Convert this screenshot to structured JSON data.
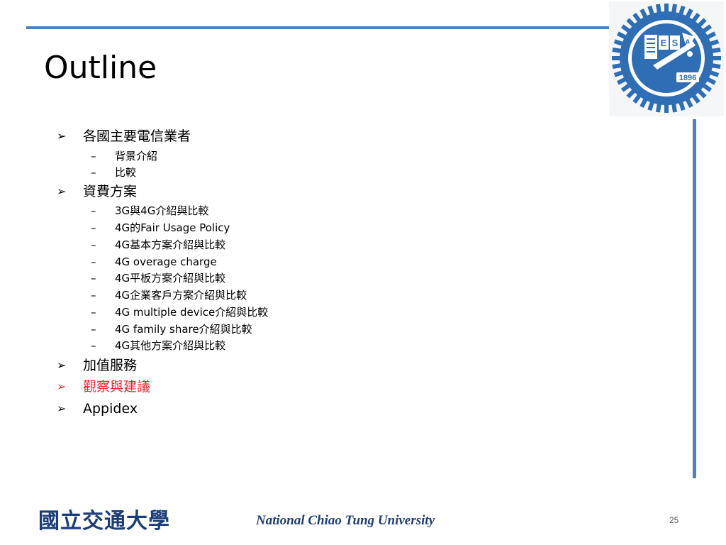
{
  "slide": {
    "title": "Outline",
    "items": [
      {
        "level": 1,
        "marker": "➢",
        "text": "各國主要電信業者",
        "highlight": false
      },
      {
        "level": 2,
        "marker": "–",
        "text": "背景介紹"
      },
      {
        "level": 2,
        "marker": "–",
        "text": "比較"
      },
      {
        "level": 1,
        "marker": "➢",
        "text": "資費方案",
        "highlight": false
      },
      {
        "level": 2,
        "marker": "–",
        "text": "3G與4G介紹與比較"
      },
      {
        "level": 2,
        "marker": "–",
        "text": "4G的Fair Usage Policy"
      },
      {
        "level": 2,
        "marker": "–",
        "text": "4G基本方案介紹與比較"
      },
      {
        "level": 2,
        "marker": "–",
        "text": "4G overage charge"
      },
      {
        "level": 2,
        "marker": "–",
        "text": "4G平板方案介紹與比較"
      },
      {
        "level": 2,
        "marker": "–",
        "text": "4G企業客戶方案介紹與比較"
      },
      {
        "level": 2,
        "marker": "–",
        "text": "4G multiple device介紹與比較"
      },
      {
        "level": 2,
        "marker": "–",
        "text": "4G family share介紹與比較"
      },
      {
        "level": 2,
        "marker": "–",
        "text": "4G其他方案介紹與比較"
      },
      {
        "level": 1,
        "marker": "➢",
        "text": "加值服務",
        "highlight": false
      },
      {
        "level": 1,
        "marker": "➢",
        "text": "觀察與建議",
        "highlight": true
      },
      {
        "level": 1,
        "marker": "➢",
        "text": "Appidex",
        "highlight": false
      }
    ],
    "footer": {
      "logo_text": "國立交通大學",
      "university": "National Chiao Tung University",
      "page_number": "25"
    },
    "seal": {
      "year": "1896",
      "letters": [
        "E",
        "S",
        "A"
      ]
    },
    "colors": {
      "accent": "#4f81bd",
      "highlight": "#e8262d",
      "footer_text": "#1f3c78",
      "seal_blue": "#2f6db5"
    }
  }
}
